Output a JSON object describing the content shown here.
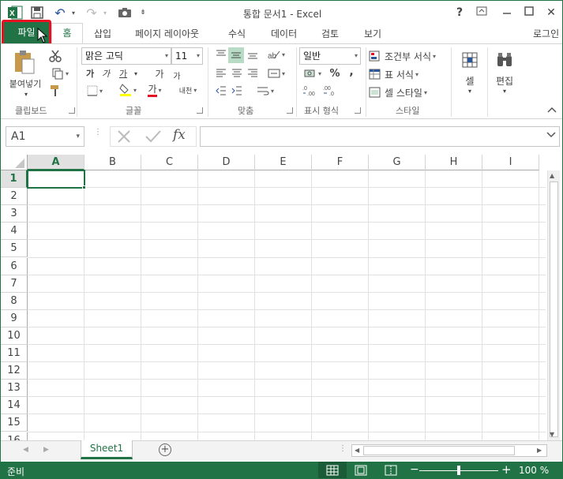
{
  "app": {
    "title": "통합 문서1 - Excel",
    "signin": "로그인",
    "help": "?",
    "ribbon_options": "⧉",
    "minimize": "—",
    "maximize": "☐",
    "close": "✕"
  },
  "qat": {
    "undo": "↶",
    "redo": "↷",
    "camera": "📷",
    "customize": "⇟"
  },
  "tabs": {
    "file": "파일",
    "home": "홈",
    "insert": "삽입",
    "page_layout": "페이지 레이아웃",
    "formulas": "수식",
    "data": "데이터",
    "review": "검토",
    "view": "보기"
  },
  "ribbon": {
    "clipboard": {
      "paste": "붙여넣기",
      "label": "클립보드"
    },
    "font": {
      "name": "맑은 고딕",
      "size": "11",
      "bold": "가",
      "italic": "가",
      "underline": "가",
      "grow": "가",
      "shrink": "가",
      "color": "가",
      "phonetic": "내천",
      "label": "글꼴"
    },
    "alignment": {
      "label": "맞춤"
    },
    "number": {
      "format": "일반",
      "percent": "%",
      "comma": ",",
      "label": "표시 형식"
    },
    "styles": {
      "conditional": "조건부 서식",
      "table": "표 서식",
      "cell_styles": "셀 스타일",
      "label": "스타일"
    },
    "cells": {
      "label": "셀"
    },
    "editing": {
      "label": "편집"
    }
  },
  "formula_bar": {
    "name_box": "A1",
    "fx": "fx",
    "value": ""
  },
  "grid": {
    "columns": [
      "A",
      "B",
      "C",
      "D",
      "E",
      "F",
      "G",
      "H",
      "I"
    ],
    "rows": [
      "1",
      "2",
      "3",
      "4",
      "5",
      "6",
      "7",
      "8",
      "9",
      "10",
      "11",
      "12",
      "13",
      "14",
      "15",
      "16"
    ],
    "active_cell": "A1"
  },
  "sheets": {
    "tabs": [
      "Sheet1"
    ],
    "add": "+"
  },
  "status": {
    "text": "준비",
    "zoom": "100 %"
  },
  "colors": {
    "accent": "#217346",
    "highlight": "#e81123"
  }
}
